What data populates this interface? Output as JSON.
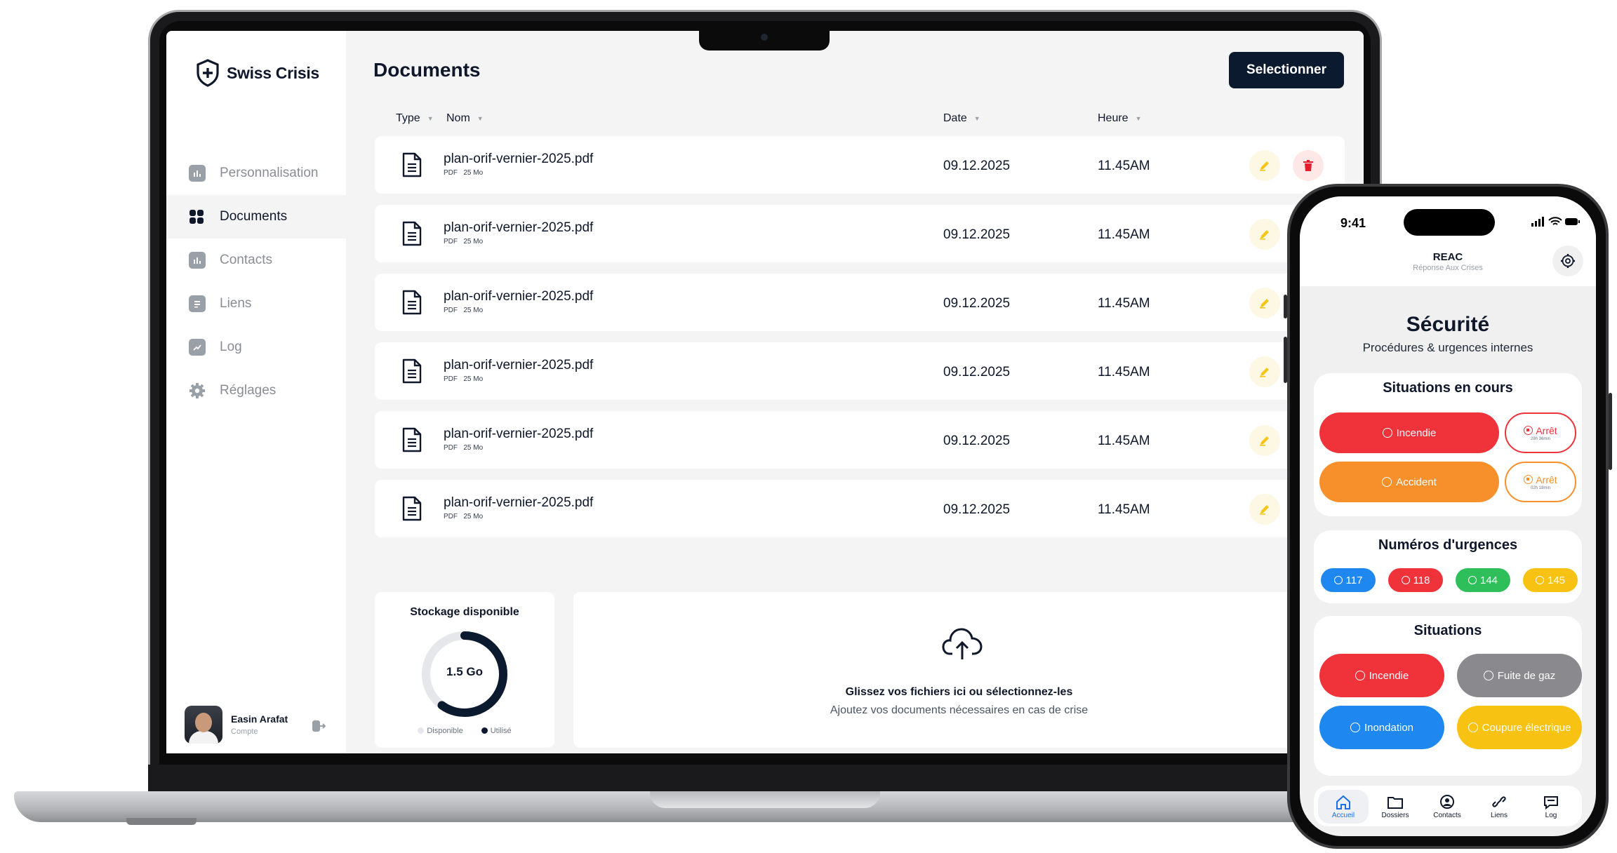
{
  "brand": {
    "name": "Swiss Crisis"
  },
  "sidebar": {
    "items": [
      {
        "label": "Personnalisation",
        "icon": "chart-icon",
        "active": false
      },
      {
        "label": "Documents",
        "icon": "grid-icon",
        "active": true
      },
      {
        "label": "Contacts",
        "icon": "chart-icon",
        "active": false
      },
      {
        "label": "Liens",
        "icon": "list-icon",
        "active": false
      },
      {
        "label": "Log",
        "icon": "trend-icon",
        "active": false
      },
      {
        "label": "Réglages",
        "icon": "gear-icon",
        "active": false
      }
    ],
    "user": {
      "name": "Easin Arafat",
      "role": "Compte"
    }
  },
  "main": {
    "title": "Documents",
    "select_button": "Selectionner",
    "columns": {
      "type": "Type",
      "name": "Nom",
      "date": "Date",
      "time": "Heure"
    },
    "rows": [
      {
        "name": "plan-orif-vernier-2025.pdf",
        "format": "PDF",
        "size": "25 Mo",
        "date": "09.12.2025",
        "time": "11.45AM"
      },
      {
        "name": "plan-orif-vernier-2025.pdf",
        "format": "PDF",
        "size": "25 Mo",
        "date": "09.12.2025",
        "time": "11.45AM"
      },
      {
        "name": "plan-orif-vernier-2025.pdf",
        "format": "PDF",
        "size": "25 Mo",
        "date": "09.12.2025",
        "time": "11.45AM"
      },
      {
        "name": "plan-orif-vernier-2025.pdf",
        "format": "PDF",
        "size": "25 Mo",
        "date": "09.12.2025",
        "time": "11.45AM"
      },
      {
        "name": "plan-orif-vernier-2025.pdf",
        "format": "PDF",
        "size": "25 Mo",
        "date": "09.12.2025",
        "time": "11.45AM"
      },
      {
        "name": "plan-orif-vernier-2025.pdf",
        "format": "PDF",
        "size": "25 Mo",
        "date": "09.12.2025",
        "time": "11.45AM"
      }
    ],
    "storage": {
      "title": "Stockage disponible",
      "value": "1.5 Go",
      "used_fraction": 0.6,
      "legend_available": "Disponible",
      "legend_used": "Utilisé"
    },
    "upload": {
      "title": "Glissez vos fichiers ici ou sélectionnez-les",
      "subtitle": "Ajoutez vos documents nécessaires en cas de crise"
    }
  },
  "phone": {
    "time": "9:41",
    "app_title": "REAC",
    "app_subtitle": "Réponse Aux Crises",
    "heading": "Sécurité",
    "subheading": "Procédures & urgences internes",
    "current": {
      "title": "Situations en cours",
      "items": [
        {
          "label": "Incendie",
          "color": "#f0323a"
        },
        {
          "label": "Arrêt",
          "note": "28h 36min",
          "color": "#f0323a"
        },
        {
          "label": "Accident",
          "color": "#f7902a"
        },
        {
          "label": "Arrêt",
          "note": "02h 18min",
          "color": "#f7902a"
        }
      ]
    },
    "emergency": {
      "title": "Numéros d'urgences",
      "numbers": [
        {
          "label": "117",
          "color": "#1e88f0"
        },
        {
          "label": "118",
          "color": "#f0323a"
        },
        {
          "label": "144",
          "color": "#2fbf5a"
        },
        {
          "label": "145",
          "color": "#f7c212"
        }
      ]
    },
    "situations": {
      "title": "Situations",
      "items": [
        {
          "label": "Incendie",
          "color": "#f0323a"
        },
        {
          "label": "Fuite de gaz",
          "color": "#8a8a8e"
        },
        {
          "label": "Inondation",
          "color": "#1e88f0"
        },
        {
          "label": "Coupure électrique",
          "color": "#f7c212"
        }
      ]
    },
    "tabs": [
      {
        "label": "Accueil",
        "active": true
      },
      {
        "label": "Dossiers",
        "active": false
      },
      {
        "label": "Contacts",
        "active": false
      },
      {
        "label": "Liens",
        "active": false
      },
      {
        "label": "Log",
        "active": false
      }
    ]
  }
}
